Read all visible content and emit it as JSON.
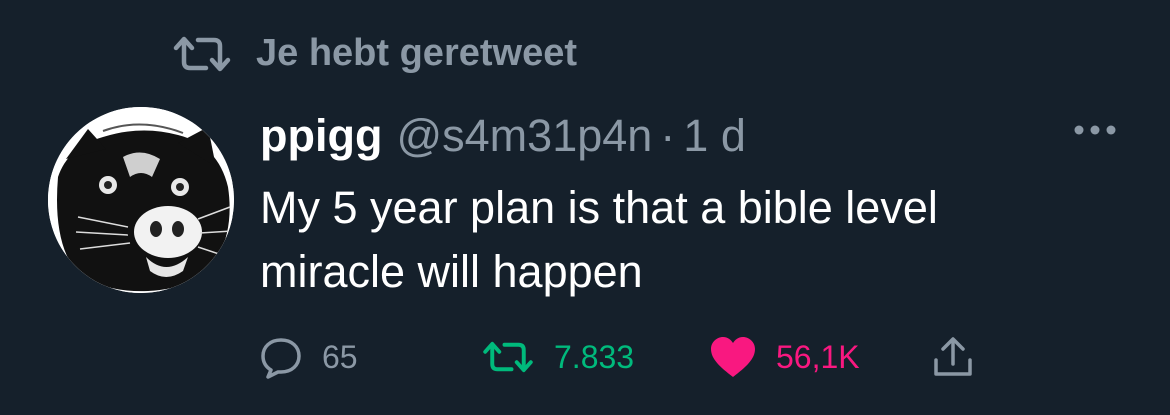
{
  "retweet_context": {
    "icon": "retweet-icon",
    "text": "Je hebt geretweet"
  },
  "tweet": {
    "author_name": "ppigg",
    "author_handle": "@s4m31p4n",
    "separator": "·",
    "timestamp": "1 d",
    "text_lines": [
      "My 5 year plan is that a bible level",
      "miracle will happen"
    ]
  },
  "actions": {
    "reply": {
      "icon": "reply-icon",
      "count": "65"
    },
    "retweet": {
      "icon": "retweet-icon",
      "count": "7.833",
      "active": true
    },
    "like": {
      "icon": "heart-icon",
      "count": "56,1K",
      "active": true
    },
    "share": {
      "icon": "share-icon"
    }
  },
  "colors": {
    "background": "#15202b",
    "text": "#ffffff",
    "muted": "#8b98a5",
    "retweet_active": "#00ba7c",
    "like_active": "#f91880"
  }
}
